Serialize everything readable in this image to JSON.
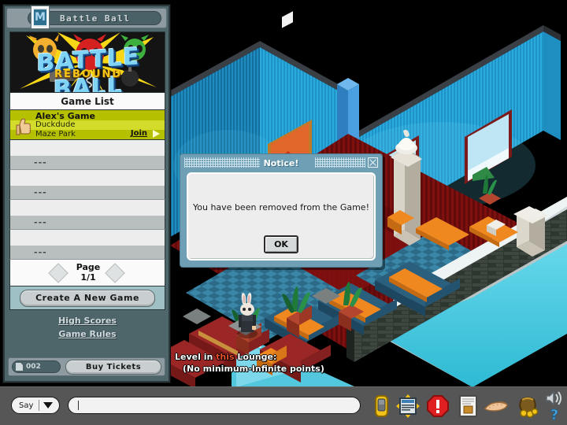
{
  "window": {
    "title": "Battle Ball",
    "logo_badge": "M",
    "logo_badge_name": "battleball-logo-icon"
  },
  "logo": {
    "word": "BATTLE BALL",
    "subtitle": "REBOUND"
  },
  "game_list": {
    "header": "Game List",
    "selected": {
      "name": "Alex's Game",
      "owner": "Duckdude",
      "map": "Maze Park",
      "join_label": "Join"
    },
    "empty_rows": [
      "---",
      "---",
      "---",
      "---"
    ]
  },
  "pager": {
    "label": "Page",
    "value": "1/1",
    "prev_icon": "left-arrow-icon",
    "next_icon": "right-arrow-icon"
  },
  "buttons": {
    "create_game": "Create A New Game",
    "buy_tickets": "Buy Tickets"
  },
  "links": {
    "high_scores": "High Scores",
    "game_rules": "Game Rules"
  },
  "tickets": {
    "count": "002",
    "icon": "ticket-icon"
  },
  "dialog": {
    "title": "Notice!",
    "message": "You have been removed from the Game!",
    "ok_label": "OK",
    "close_icon": "close-icon"
  },
  "lounge": {
    "line1_a": "Level in ",
    "line1_b": "this",
    "line1_c": " Lounge:",
    "line2": "(No minimum-Infinite points)",
    "highlight_color": "#e8502a"
  },
  "chat": {
    "mode": "Say",
    "placeholder": "",
    "value": ""
  },
  "toolbar_icons": [
    {
      "name": "mobile-phone-icon",
      "label": "Console"
    },
    {
      "name": "navigator-window-icon",
      "label": "Navigator"
    },
    {
      "name": "alert-octagon-icon",
      "label": "Alert"
    },
    {
      "name": "catalogue-book-icon",
      "label": "Catalogue"
    },
    {
      "name": "hand-icon",
      "label": "Hand"
    },
    {
      "name": "coin-purse-icon",
      "label": "Credits"
    },
    {
      "name": "speaker-icon",
      "label": "Sound"
    },
    {
      "name": "question-mark-icon",
      "label": "Help"
    }
  ],
  "colors": {
    "panel_bg": "#4e6569",
    "selected_row": "#b9c400",
    "dialog_frame": "#6e9fb4",
    "wall": "#29a8dd",
    "floor_red": "#8d1212",
    "floor_blue": "#2f6f8f",
    "water": "#46c8e0",
    "toolbar_bg": "#565656"
  }
}
